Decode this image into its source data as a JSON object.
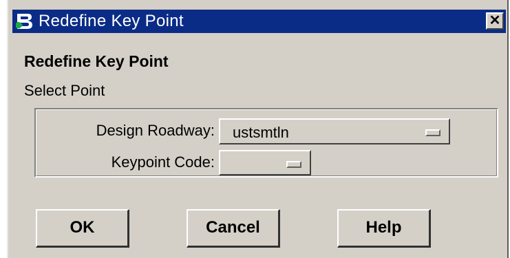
{
  "window": {
    "title": "Redefine Key Point",
    "close_glyph": "✕",
    "icon": "bentley-logo-icon"
  },
  "dialog": {
    "heading": "Redefine Key Point",
    "subheading": "Select Point"
  },
  "fields": {
    "design_roadway": {
      "label": "Design Roadway:",
      "value": "ustsmtln"
    },
    "keypoint_code": {
      "label": "Keypoint Code:",
      "value": ""
    }
  },
  "buttons": {
    "ok": "OK",
    "cancel": "Cancel",
    "help": "Help"
  },
  "colors": {
    "titlebar": "#0a2c86",
    "face": "#d4d0c8"
  }
}
